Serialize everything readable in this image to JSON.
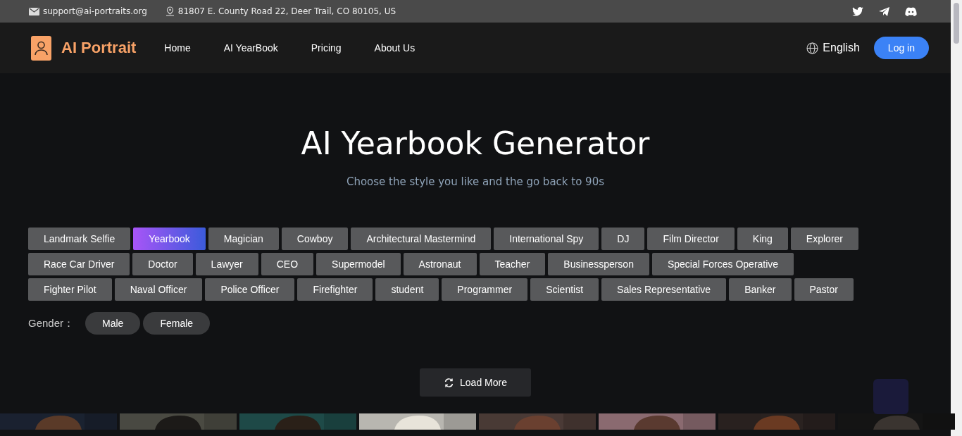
{
  "top_bar": {
    "email": "support@ai-portraits.org",
    "address": "81807 E. County Road 22, Deer Trail, CO 80105, US"
  },
  "nav": {
    "logo": "AI Portrait",
    "links": [
      "Home",
      "AI YearBook",
      "Pricing",
      "About Us"
    ],
    "language": "English",
    "login": "Log in"
  },
  "hero": {
    "title": "AI Yearbook Generator",
    "subtitle": "Choose the style you like and the go back to 90s"
  },
  "style_rows": [
    [
      {
        "label": "Landmark Selfie",
        "selected": false
      },
      {
        "label": "Yearbook",
        "selected": true
      },
      {
        "label": "Magician",
        "selected": false
      },
      {
        "label": "Cowboy",
        "selected": false
      },
      {
        "label": "Architectural Mastermind",
        "selected": false
      },
      {
        "label": "International Spy",
        "selected": false
      },
      {
        "label": "DJ",
        "selected": false
      },
      {
        "label": "Film Director",
        "selected": false
      },
      {
        "label": "King",
        "selected": false
      },
      {
        "label": "Explorer",
        "selected": false
      }
    ],
    [
      {
        "label": "Race Car Driver",
        "selected": false
      },
      {
        "label": "Doctor",
        "selected": false
      },
      {
        "label": "Lawyer",
        "selected": false
      },
      {
        "label": "CEO",
        "selected": false
      },
      {
        "label": "Supermodel",
        "selected": false
      },
      {
        "label": "Astronaut",
        "selected": false
      },
      {
        "label": "Teacher",
        "selected": false
      },
      {
        "label": "Businessperson",
        "selected": false
      },
      {
        "label": "Special Forces Operative",
        "selected": false
      }
    ],
    [
      {
        "label": "Fighter Pilot",
        "selected": false
      },
      {
        "label": "Naval Officer",
        "selected": false
      },
      {
        "label": "Police Officer",
        "selected": false
      },
      {
        "label": "Firefighter",
        "selected": false
      },
      {
        "label": "student",
        "selected": false
      },
      {
        "label": "Programmer",
        "selected": false
      },
      {
        "label": "Scientist",
        "selected": false
      },
      {
        "label": "Sales Representative",
        "selected": false
      },
      {
        "label": "Banker",
        "selected": false
      },
      {
        "label": "Pastor",
        "selected": false
      }
    ]
  ],
  "gender": {
    "label": "Gender：",
    "options": [
      {
        "label": "Male",
        "selected": false
      },
      {
        "label": "Female",
        "selected": false
      }
    ]
  },
  "load_more": "Load More",
  "gallery": [
    {
      "kind": "picture"
    },
    {
      "kind": "picture"
    },
    {
      "kind": "picture"
    },
    {
      "kind": "picture"
    },
    {
      "kind": "picture"
    },
    {
      "kind": "picture"
    },
    {
      "kind": "picture"
    },
    {
      "kind": "picture"
    }
  ]
}
